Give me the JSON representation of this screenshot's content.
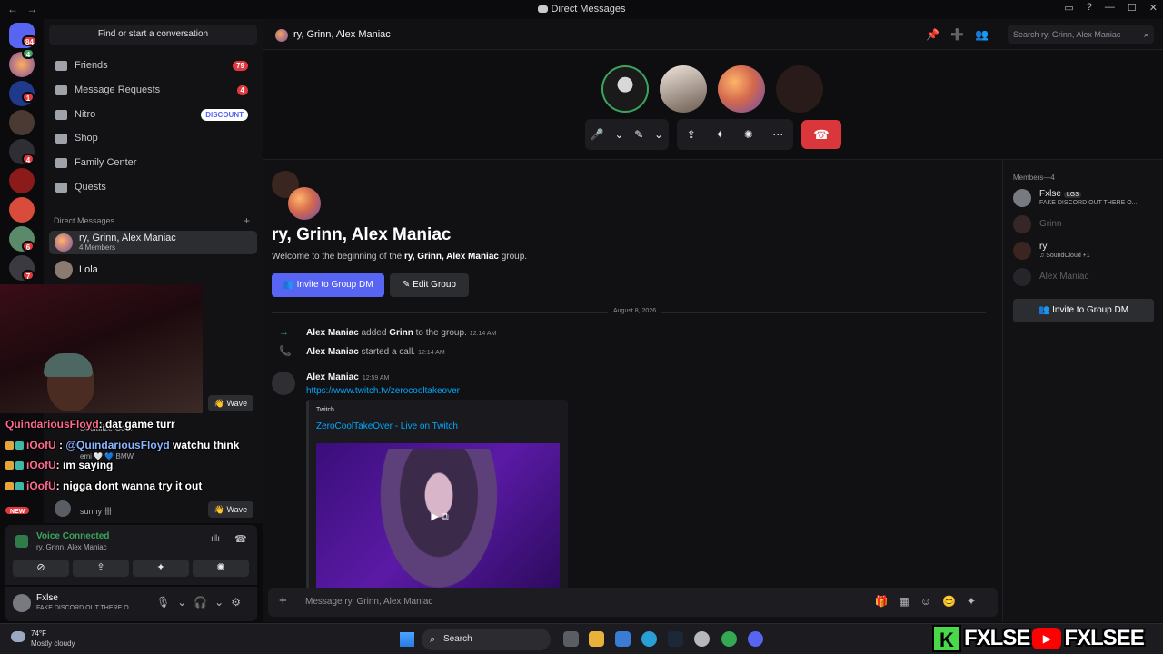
{
  "window": {
    "title": "Direct Messages",
    "nav_back": "←",
    "nav_forward": "→",
    "controls": [
      "▭",
      "?",
      "—",
      "☐",
      "✕"
    ]
  },
  "rail": {
    "badges": [
      "84",
      "4",
      "1",
      "4",
      "6",
      "7"
    ],
    "new_label": "NEW"
  },
  "sidebar": {
    "find_placeholder": "Find or start a conversation",
    "nav": [
      {
        "label": "Friends",
        "count": "79"
      },
      {
        "label": "Message Requests",
        "count": "4"
      },
      {
        "label": "Nitro",
        "pill": "DISCOUNT"
      },
      {
        "label": "Shop"
      },
      {
        "label": "Family Center"
      },
      {
        "label": "Quests"
      }
    ],
    "dm_header": "Direct Messages",
    "dm_add": "+",
    "dms": [
      {
        "name": "ry, Grinn, Alex Maniac",
        "sub": "4 Members"
      },
      {
        "name": "Lola"
      }
    ]
  },
  "overlay": {
    "wave_label": "👋 Wave",
    "chat": [
      {
        "user": "QuindariousFloyd",
        "text": ": dat game turr"
      },
      {
        "user": "iOofU",
        "mention": "@QuindariousFloyd",
        "text": " watchu think"
      },
      {
        "user": "iOofU",
        "text": ": im saying"
      },
      {
        "user": "iOofU",
        "text": ": nigga dont wanna try it out"
      }
    ],
    "faint_1": "Socialize Core",
    "faint_2": "emi 🤍 💙 BMW",
    "faint_3": "sunny",
    "faint_3_badge": "卌"
  },
  "voice": {
    "status": "Voice Connected",
    "channel": "ry, Grinn, Alex Maniac",
    "buttons": [
      "⊘",
      "⇪",
      "✦",
      "✺"
    ],
    "wave_icon": "ıllı",
    "disconnect_icon": "☎"
  },
  "user": {
    "name": "Fxlse",
    "status": "FAKE DISCORD OUT THERE O...",
    "controls": "🎙⌄🎧⌄⚙"
  },
  "header": {
    "title": "ry, Grinn, Alex Maniac",
    "icons": "📌➕👥",
    "search_placeholder": "Search ry, Grinn, Alex Maniac",
    "search_icon": "⌕"
  },
  "call": {
    "controls_1": [
      "🎤",
      "⌄",
      "✎",
      "⌄"
    ],
    "controls_2": [
      "⇪",
      "✦",
      "✺",
      "⋯"
    ],
    "hangup": "☎"
  },
  "welcome": {
    "title": "ry, Grinn, Alex Maniac",
    "intro_pre": "Welcome to the beginning of the ",
    "intro_bold": "ry, Grinn, Alex Maniac",
    "intro_post": " group.",
    "invite_label": "Invite to Group DM",
    "edit_label": "Edit Group"
  },
  "divider_date": "August 8, 2026",
  "system": [
    {
      "icon": "→",
      "actor": "Alex Maniac",
      "verb": " added ",
      "target": "Grinn",
      "rest": " to the group.",
      "time": "12:14 AM"
    },
    {
      "icon": "📞",
      "actor": "Alex Maniac",
      "verb": " started a call.",
      "target": "",
      "rest": "",
      "time": "12:14 AM"
    }
  ],
  "message": {
    "author": "Alex Maniac",
    "time": "12:59 AM",
    "link": "https://www.twitch.tv/zerocooltakeover",
    "embed": {
      "provider": "Twitch",
      "title": "ZeroCoolTakeOver - Live on Twitch",
      "play": "▶ ⧉"
    }
  },
  "composer": {
    "plus": "+",
    "placeholder": "Message ry, Grinn, Alex Maniac",
    "icons": "🎁▦☺😊✦"
  },
  "members": {
    "header": "Members—4",
    "list": [
      {
        "name": "Fxlse",
        "tag": "LG3",
        "status": "FAKE DISCORD OUT THERE O...",
        "online": true
      },
      {
        "name": "Grinn",
        "online": false
      },
      {
        "name": "ry",
        "status": "♫ SoundCloud +1",
        "online": true
      },
      {
        "name": "Alex Maniac",
        "online": false
      }
    ],
    "invite_label": "Invite to Group DM"
  },
  "taskbar": {
    "temp": "74°F",
    "weather": "Mostly cloudy",
    "search": "Search",
    "search_icon": "⌕"
  },
  "branding": {
    "k": "K",
    "name_1": "FXLSE",
    "yt": "▶",
    "name_2": "FXLSEE"
  },
  "colors": {
    "blurple": "#5865f2",
    "green": "#3ba55d",
    "red": "#da373c",
    "link": "#00a8fc"
  }
}
